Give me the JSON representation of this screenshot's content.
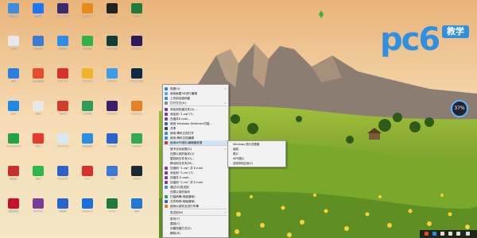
{
  "colors": {
    "sky_top": "#f2c48a",
    "sky_mid": "#f6dbb0",
    "mountain": "#8d7f75",
    "meadow": "#6f9a2e",
    "meadow_light": "#a8c43f",
    "flowers": "#f3d23a",
    "accent": "#2f8fe0"
  },
  "watermark": {
    "brand": "pc6",
    "badge": "教学"
  },
  "meter": {
    "value": "37%"
  },
  "desktop_icons": [
    {
      "label": "腾讯QQ",
      "icon": "app-icon",
      "color": "#3a8de0"
    },
    {
      "label": "支付宝",
      "icon": "app-icon",
      "color": "#1677ff"
    },
    {
      "label": "Adobe AE",
      "icon": "app-icon",
      "color": "#3a2a6e"
    },
    {
      "label": "Adobe Ai",
      "icon": "app-icon",
      "color": "#e88a1c"
    },
    {
      "label": "剪映",
      "icon": "app-icon",
      "color": "#222222"
    },
    {
      "label": "Excel",
      "icon": "app-icon",
      "color": "#1f7a3e"
    },
    {
      "label": "文档",
      "icon": "file-icon",
      "color": "#e8e8e8"
    },
    {
      "label": "此电脑",
      "icon": "app-icon",
      "color": "#3b7bd6"
    },
    {
      "label": "浏览器",
      "icon": "app-icon",
      "color": "#2c8ce6"
    },
    {
      "label": "QQ音乐",
      "icon": "app-icon",
      "color": "#33b04a"
    },
    {
      "label": "Adobe Au",
      "icon": "app-icon",
      "color": "#0f3d3a"
    },
    {
      "label": "Adobe Pr",
      "icon": "app-icon",
      "color": "#2a1a5a"
    },
    {
      "label": "迅雷",
      "icon": "app-icon",
      "color": "#2b7fe0"
    },
    {
      "label": "360浏览器",
      "icon": "app-icon",
      "color": "#e84a2c"
    },
    {
      "label": "WPS PDF",
      "icon": "app-icon",
      "color": "#d8312b"
    },
    {
      "label": "Windows",
      "icon": "app-icon",
      "color": "#f0b429"
    },
    {
      "label": "Chrome",
      "icon": "app-icon",
      "color": "#3f9be8"
    },
    {
      "label": "Photoshop",
      "icon": "app-icon",
      "color": "#0b2a47"
    },
    {
      "label": "Edge",
      "icon": "app-icon",
      "color": "#1e88e5"
    },
    {
      "label": "微信",
      "icon": "app-icon",
      "color": "#e8e8e8"
    },
    {
      "label": "素材库",
      "icon": "app-icon",
      "color": "#d23c2a"
    },
    {
      "label": "QQ游戏",
      "icon": "app-icon",
      "color": "#2c9c5a"
    },
    {
      "label": "Premiere",
      "icon": "app-icon",
      "color": "#3b1d6e"
    },
    {
      "label": "Illustrator",
      "icon": "app-icon",
      "color": "#e67e22"
    },
    {
      "label": "Excel工作簿",
      "icon": "app-icon",
      "color": "#25a244"
    },
    {
      "label": "WPS",
      "icon": "app-icon",
      "color": "#e83a2c"
    },
    {
      "label": "OneDrive",
      "icon": "app-icon",
      "color": "#d9e8f5"
    },
    {
      "label": "腾讯视频",
      "icon": "app-icon",
      "color": "#2b8ee0"
    },
    {
      "label": "PDF编辑",
      "icon": "app-icon",
      "color": "#2b64c8"
    },
    {
      "label": "Chrome",
      "icon": "app-icon",
      "color": "#34a853"
    },
    {
      "label": "网易云",
      "icon": "app-icon",
      "color": "#c62f2f"
    },
    {
      "label": "微信",
      "icon": "app-icon",
      "color": "#2db84d"
    },
    {
      "label": "WPS文字",
      "icon": "app-icon",
      "color": "#2b64c8"
    },
    {
      "label": "PDF",
      "icon": "app-icon",
      "color": "#d8312b"
    },
    {
      "label": "飞书",
      "icon": "app-icon",
      "color": "#3a7bd5"
    },
    {
      "label": "Steam",
      "icon": "app-icon",
      "color": "#1b2838"
    },
    {
      "label": "网易邮箱",
      "icon": "app-icon",
      "color": "#c8102e"
    },
    {
      "label": "WinRAR",
      "icon": "app-icon",
      "color": "#7a3b9a"
    },
    {
      "label": "压缩包",
      "icon": "app-icon",
      "color": "#2b64c8"
    },
    {
      "label": "Windows",
      "icon": "app-icon",
      "color": "#1e6fd9"
    },
    {
      "label": "Excel",
      "icon": "app-icon",
      "color": "#1f7a3e"
    },
    {
      "label": "钉钉",
      "icon": "app-icon",
      "color": "#1f78d1"
    }
  ],
  "context_menu": [
    {
      "label": "查看(V)",
      "icon": "view-icon",
      "color": "#3b7bd6",
      "arrow": true
    },
    {
      "label": "使用画图3D进行编辑",
      "icon": "paint3d-icon",
      "color": "#5aa0e8"
    },
    {
      "label": "上传到百度网盘",
      "icon": "cloud-icon",
      "color": "#2b8ee0"
    },
    {
      "label": "打开方式(H)",
      "icon": "open-icon",
      "color": "#888888",
      "arrow": true
    },
    {
      "label": "添加到压缩文件(A)...",
      "icon": "archive-icon",
      "color": "#7a3b9a"
    },
    {
      "label": "添加到 \"1.zip\"(T)",
      "icon": "archive-icon",
      "color": "#7a3b9a"
    },
    {
      "label": "压缩并E-mail...",
      "icon": "archive-icon",
      "color": "#7a3b9a"
    },
    {
      "label": "使用 Windows Defender扫描...",
      "icon": "shield-icon",
      "color": "#2b64c8"
    },
    {
      "label": "共享",
      "icon": "share-icon",
      "color": "#444444"
    },
    {
      "label": "使用 腾讯文档打开",
      "icon": "doc-icon",
      "color": "#2b8ee0"
    },
    {
      "label": "使用 腾讯文档编辑",
      "icon": "doc-icon",
      "color": "#2b8ee0"
    },
    {
      "label": "使用WPS图片编辑器查看",
      "icon": "image-icon",
      "color": "#d8312b",
      "highlight": true
    },
    {
      "label": "授予访问权限(G)",
      "icon": "",
      "color": "",
      "arrow": true
    },
    {
      "label": "还原以前的版本(V)",
      "icon": "",
      "color": ""
    },
    {
      "label": "复制到文件夹(O)...",
      "icon": "",
      "color": ""
    },
    {
      "label": "移动到文件夹(M)...",
      "icon": "",
      "color": ""
    },
    {
      "label": "压缩到 \"1.zip\" 并 E-mail",
      "icon": "archive-icon",
      "color": "#7a3b9a"
    },
    {
      "label": "添加到 \"1.rar\"(T)",
      "icon": "archive-icon",
      "color": "#7a3b9a"
    },
    {
      "label": "压缩并 E-mail...",
      "icon": "archive-icon",
      "color": "#7a3b9a"
    },
    {
      "label": "压缩到 \"1.rar\" 并 E-mail",
      "icon": "archive-icon",
      "color": "#7a3b9a"
    },
    {
      "label": "通过QQ发送到",
      "icon": "qq-icon",
      "color": "#3a8de0"
    },
    {
      "label": "还原以前的版本",
      "icon": "",
      "color": ""
    },
    {
      "label": "扫描病毒(电脑管家)",
      "icon": "scan-icon",
      "color": "#2c9c5a"
    },
    {
      "label": "文件粉碎(电脑管家)",
      "icon": "shred-icon",
      "color": "#2b64c8"
    },
    {
      "label": "使用火绒安全进行杀毒",
      "icon": "fire-icon",
      "color": "#e8731c"
    },
    {
      "label": "发送到(N)",
      "icon": "",
      "color": "",
      "arrow": true
    },
    {
      "label": "剪切(T)",
      "icon": "",
      "color": ""
    },
    {
      "label": "复制(C)",
      "icon": "",
      "color": ""
    },
    {
      "label": "创建快捷方式(S)",
      "icon": "",
      "color": ""
    },
    {
      "label": "删除(D)",
      "icon": "",
      "color": ""
    }
  ],
  "submenu": [
    {
      "label": "Windows 照片查看器"
    },
    {
      "label": "画图"
    },
    {
      "label": "照片"
    },
    {
      "label": "WPS图片"
    },
    {
      "label": "选择其他应用(C)"
    }
  ]
}
